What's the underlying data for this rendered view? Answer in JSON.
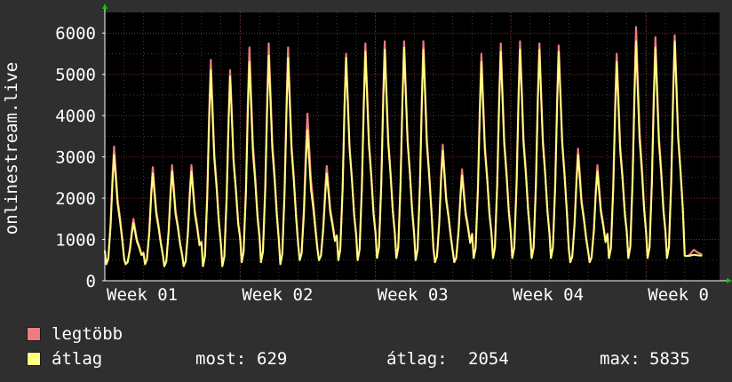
{
  "chart_data": {
    "type": "line",
    "ylabel": "onlinestream.live",
    "ylim": [
      0,
      6500
    ],
    "yticks": [
      0,
      1000,
      2000,
      3000,
      4000,
      5000,
      6000
    ],
    "xtick_labels": [
      "Week 01",
      "Week 02",
      "Week 03",
      "Week 04",
      "Week 0"
    ],
    "grid": true,
    "days_shown": 32,
    "series": [
      {
        "name": "legtöbb",
        "color": "#f07a82",
        "daily_peaks": [
          3250,
          1500,
          2750,
          2800,
          2800,
          5350,
          5100,
          5650,
          5750,
          5650,
          4050,
          2780,
          5500,
          5750,
          5800,
          5800,
          5800,
          3300,
          2700,
          5500,
          5750,
          5800,
          5750,
          5700,
          3200,
          2800,
          5500,
          6150,
          5900,
          5950,
          750
        ],
        "daily_troughs": [
          400,
          400,
          400,
          350,
          350,
          350,
          350,
          450,
          450,
          400,
          500,
          500,
          500,
          500,
          550,
          550,
          500,
          450,
          450,
          550,
          550,
          550,
          550,
          550,
          450,
          450,
          550,
          550,
          550,
          550,
          600
        ]
      },
      {
        "name": "átlag",
        "color": "#ffff80",
        "daily_peaks": [
          3050,
          1400,
          2600,
          2650,
          2650,
          5100,
          4950,
          5300,
          5450,
          5400,
          3650,
          2600,
          5400,
          5550,
          5600,
          5650,
          5600,
          3150,
          2550,
          5300,
          5550,
          5600,
          5600,
          5550,
          3050,
          2650,
          5300,
          5800,
          5650,
          5800,
          629
        ],
        "daily_troughs": [
          400,
          400,
          400,
          350,
          350,
          350,
          350,
          450,
          450,
          400,
          500,
          500,
          500,
          500,
          550,
          550,
          500,
          450,
          450,
          550,
          550,
          550,
          550,
          550,
          450,
          450,
          550,
          550,
          550,
          550,
          600
        ]
      }
    ]
  },
  "legend": {
    "max_label": "legtöbb",
    "avg_label": "átlag",
    "most_label": "most:",
    "most_value": "629",
    "avg_stat_label": "átlag:",
    "avg_stat_value": "2054",
    "max_stat_label": "max:",
    "max_stat_value": "5835"
  },
  "colors": {
    "background": "#2f2f2f",
    "plot_background": "#000000",
    "grid_major": "#803030",
    "grid_minor": "#3a3a3a",
    "axis": "#ffffff",
    "arrow": "#00cc00"
  }
}
